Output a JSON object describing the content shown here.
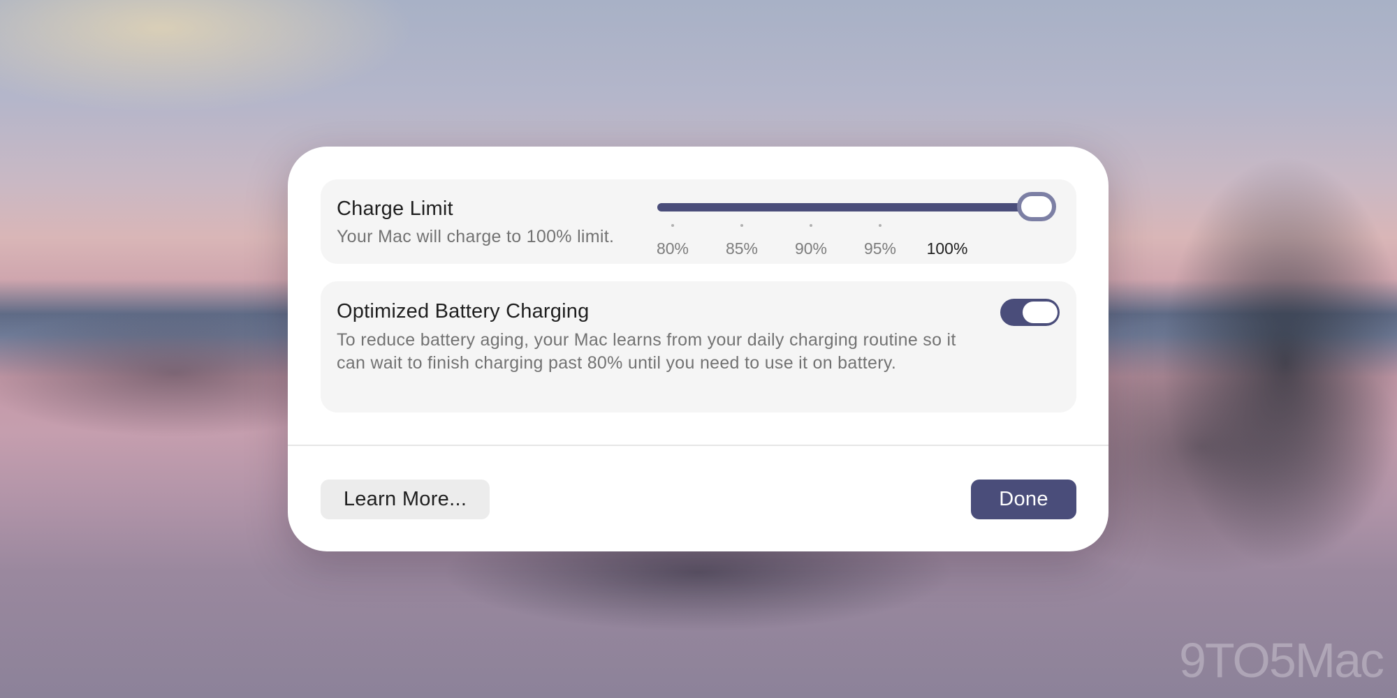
{
  "dialog": {
    "charge_limit": {
      "title": "Charge Limit",
      "description": "Your Mac will charge to 100% limit.",
      "slider": {
        "ticks": [
          "80%",
          "85%",
          "90%",
          "95%",
          "100%"
        ],
        "selected": "100%",
        "value_fraction": 1.0
      }
    },
    "optimized_charging": {
      "title": "Optimized Battery Charging",
      "description": "To reduce battery aging, your Mac learns from your daily charging routine so it can wait to finish charging past 80% until you need to use it on battery.",
      "toggle_on": true
    },
    "buttons": {
      "learn_more": "Learn More...",
      "done": "Done"
    }
  },
  "watermark": "9TO5Mac",
  "colors": {
    "accent": "#4a4d7a",
    "card_background": "#f5f5f5",
    "dialog_background": "#ffffff"
  }
}
